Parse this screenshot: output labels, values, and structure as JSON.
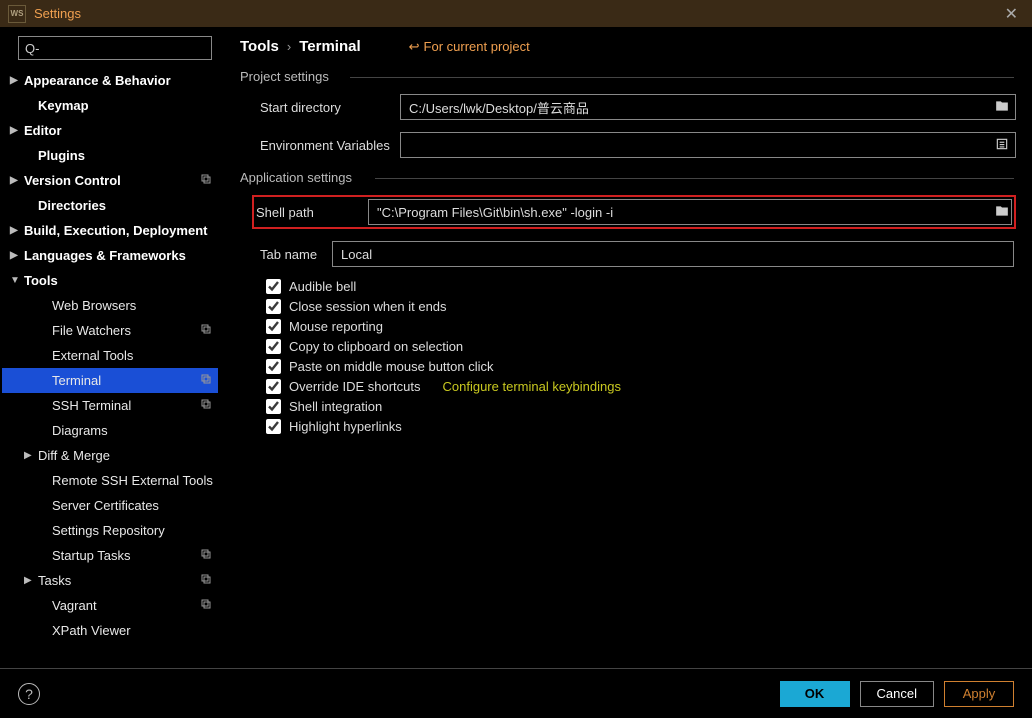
{
  "window": {
    "title": "Settings",
    "logo": "WS"
  },
  "search": {
    "placeholder": "Q-"
  },
  "sidebar": {
    "items": [
      {
        "label": "Appearance & Behavior",
        "arrow": "▶",
        "bold": true
      },
      {
        "label": "Keymap",
        "bold": true,
        "indent": 1
      },
      {
        "label": "Editor",
        "arrow": "▶",
        "bold": true
      },
      {
        "label": "Plugins",
        "bold": true,
        "indent": 1
      },
      {
        "label": "Version Control",
        "arrow": "▶",
        "bold": true,
        "copy": true
      },
      {
        "label": "Directories",
        "bold": true,
        "indent": 1
      },
      {
        "label": "Build, Execution, Deployment",
        "arrow": "▶",
        "bold": true
      },
      {
        "label": "Languages & Frameworks",
        "arrow": "▶",
        "bold": true
      },
      {
        "label": "Tools",
        "arrow": "▼",
        "bold": true
      },
      {
        "label": "Web Browsers",
        "indent": 2
      },
      {
        "label": "File Watchers",
        "indent": 2,
        "copy": true
      },
      {
        "label": "External Tools",
        "indent": 2
      },
      {
        "label": "Terminal",
        "indent": 2,
        "selected": true,
        "copy": true
      },
      {
        "label": "SSH Terminal",
        "indent": 2,
        "copy": true
      },
      {
        "label": "Diagrams",
        "indent": 2
      },
      {
        "label": "Diff & Merge",
        "arrow": "▶",
        "indent": 1
      },
      {
        "label": "Remote SSH External Tools",
        "indent": 2
      },
      {
        "label": "Server Certificates",
        "indent": 2
      },
      {
        "label": "Settings Repository",
        "indent": 2
      },
      {
        "label": "Startup Tasks",
        "indent": 2,
        "copy": true
      },
      {
        "label": "Tasks",
        "arrow": "▶",
        "indent": 1,
        "copy": true
      },
      {
        "label": "Vagrant",
        "indent": 2,
        "copy": true
      },
      {
        "label": "XPath Viewer",
        "indent": 2
      }
    ]
  },
  "breadcrumb": {
    "root": "Tools",
    "sep": "›",
    "current": "Terminal",
    "for_project": "For current project"
  },
  "sections": {
    "project": {
      "title": "Project settings",
      "start_dir_label": "Start directory",
      "start_dir_value": "C:/Users/lwk/Desktop/普云商品",
      "env_label": "Environment Variables",
      "env_value": ""
    },
    "app": {
      "title": "Application settings",
      "shell_label": "Shell path",
      "shell_value": "\"C:\\Program Files\\Git\\bin\\sh.exe\" -login -i",
      "tab_label": "Tab name",
      "tab_value": "Local",
      "checks": [
        "Audible bell",
        "Close session when it ends",
        "Mouse reporting",
        "Copy to clipboard on selection",
        "Paste on middle mouse button click",
        "Override IDE shortcuts",
        "Shell integration",
        "Highlight hyperlinks"
      ],
      "config_link": "Configure terminal keybindings"
    }
  },
  "footer": {
    "ok": "OK",
    "cancel": "Cancel",
    "apply": "Apply"
  }
}
